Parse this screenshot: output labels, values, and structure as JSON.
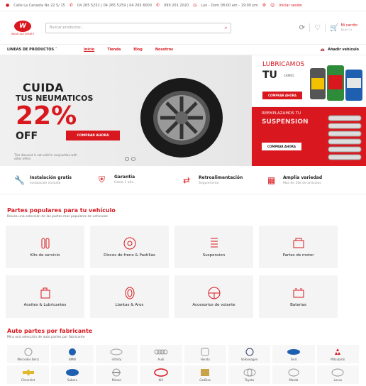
{
  "topbar": {
    "address": "Calle La Canasta No 22 S/ 15",
    "phones": "04 265 5252 | 04 265 5259 | 04 265 6000",
    "whatsapp": "099 201 2020",
    "hours": "Lun - Dom 08:00 am - 19:00 pm",
    "login": "Iniciar sesión"
  },
  "header": {
    "logo_text": "W",
    "logo_tag": "WEAR AUTOPARTS",
    "search_placeholder": "Buscar productos...",
    "cart_title": "Mi carrito",
    "cart_sub": "$0.00 / 0"
  },
  "nav": {
    "product_lines": "LINEAS DE PRODUCTOS ˅",
    "links": [
      "Inicio",
      "Tienda",
      "Blog",
      "Nosotros"
    ],
    "add_vehicle": "Añadir vehículo"
  },
  "hero": {
    "line1": "CUIDA",
    "line2": "TUS NEUMATICOS",
    "percent": "22%",
    "off": "OFF",
    "button": "COMPRAR AHORA",
    "note": "This discount is not valid in conjunction with other offers"
  },
  "promo1": {
    "line1": "LUBRICAMOS",
    "line2": "TU",
    "line3": "CARRO",
    "button": "COMPRAR AHORA"
  },
  "promo2": {
    "line1": "REEMPLAZAMOS TU",
    "line2": "SUSPENSION",
    "button": "COMPRAR AHORA"
  },
  "features": [
    {
      "title": "Instalación gratis",
      "sub": "Instalación incluida",
      "icon": "wrench-icon"
    },
    {
      "title": "Garantia",
      "sub": "Hasta 1 año",
      "icon": "shield-icon"
    },
    {
      "title": "Retroalimentación",
      "sub": "Seguimiento",
      "icon": "arrows-icon"
    },
    {
      "title": "Amplia variedad",
      "sub": "Mas de 10k de articulos",
      "icon": "store-icon"
    }
  ],
  "popular": {
    "title": "Partes populares para tu vehículo",
    "sub": "Revisa una selección de las partes mas populares de vehiculos",
    "items": [
      "Kits de servicio",
      "Discos de freno & Pastillas",
      "Suspension",
      "Partes de motor",
      "Aceites & Lubricantes",
      "Llantas & Aros",
      "Accesorios de volante",
      "Baterias"
    ]
  },
  "makers": {
    "title": "Auto partes por fabricante",
    "sub": "Mira una selección de auto partes por fabricante",
    "brands": [
      "Mercedes Benz",
      "BMW",
      "Infinity",
      "Audi",
      "Honda",
      "Volkswagen",
      "Ford",
      "Mitsubishi",
      "Chevrolet",
      "Subaru",
      "Nissan",
      "KIA",
      "Cadillac",
      "Toyota",
      "Mazda",
      "Lexus"
    ]
  },
  "colors": {
    "accent": "#d8171e"
  }
}
